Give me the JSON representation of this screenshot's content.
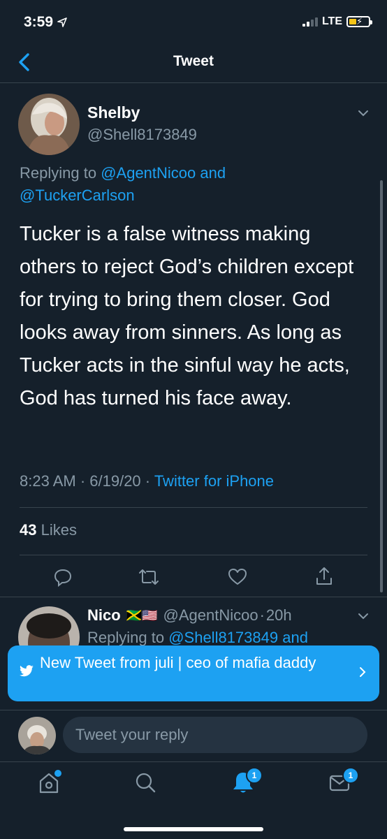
{
  "status": {
    "time": "3:59",
    "network": "LTE"
  },
  "nav": {
    "title": "Tweet"
  },
  "tweet": {
    "name": "Shelby",
    "handle": "@Shell8173849",
    "replying_prefix": "Replying to",
    "replying_user1": "@AgentNicoo",
    "replying_and": "and",
    "replying_user2": "@TuckerCarlson",
    "text": "Tucker is a false witness making others to reject God’s children except for trying to bring them closer. God looks away from sinners. As long as Tucker acts in the sinful way he acts, God has turned his face away.",
    "time": "8:23 AM · 6/19/20 ·",
    "source": "Twitter for iPhone",
    "likes_count": "43",
    "likes_label": "Likes"
  },
  "reply": {
    "name": "Nico",
    "flags": "🇯🇲🇺🇸",
    "handle": "@AgentNicoo",
    "sep": "·",
    "age": "20h",
    "replying_prefix": "Replying to",
    "replying_user": "@Shell8173849",
    "replying_and": "and"
  },
  "banner": {
    "text": "New Tweet from juli | ceo of mafia daddy"
  },
  "compose": {
    "placeholder": "Tweet your reply"
  },
  "tabbar": {
    "notifications_badge": "1",
    "messages_badge": "1"
  },
  "colors": {
    "background": "#15202b",
    "accent": "#1da1f2",
    "secondary_text": "#8899a6",
    "divider": "#38444d"
  }
}
